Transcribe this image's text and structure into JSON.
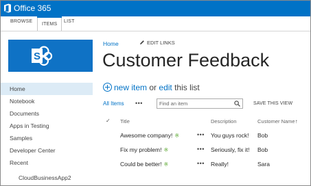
{
  "suite": {
    "brand": "Office 365",
    "color": "#0072c6"
  },
  "ribbon": {
    "tabs": [
      "BROWSE",
      "ITEMS",
      "LIST"
    ],
    "selected": "ITEMS"
  },
  "nav": {
    "home": "Home",
    "edit_links": "EDIT LINKS"
  },
  "page": {
    "title": "Customer Feedback"
  },
  "quick_launch": {
    "items": [
      "Home",
      "Notebook",
      "Documents",
      "Apps in Testing",
      "Samples",
      "Developer Center",
      "Recent"
    ],
    "sub_items": [
      "CloudBusinessApp2"
    ],
    "selected": "Home"
  },
  "command": {
    "new_item": "new item",
    "or": "or",
    "edit": "edit",
    "this_list": "this list"
  },
  "view": {
    "all_items": "All Items",
    "ellipsis": "•••",
    "search_placeholder": "Find an item",
    "save_view": "SAVE THIS VIEW"
  },
  "table": {
    "check_header": "✓",
    "columns": [
      "Title",
      "Description",
      "Customer Name"
    ],
    "sort_indicator": "↑",
    "new_badge": "※",
    "row_menu": "•••",
    "rows": [
      {
        "title": "Awesome company!",
        "description": "You guys rock!",
        "customer": "Bob"
      },
      {
        "title": "Fix my problem!",
        "description": "Seriously, fix it!",
        "customer": "Bob"
      },
      {
        "title": "Could be better!",
        "description": "Really!",
        "customer": "Sara"
      }
    ]
  }
}
